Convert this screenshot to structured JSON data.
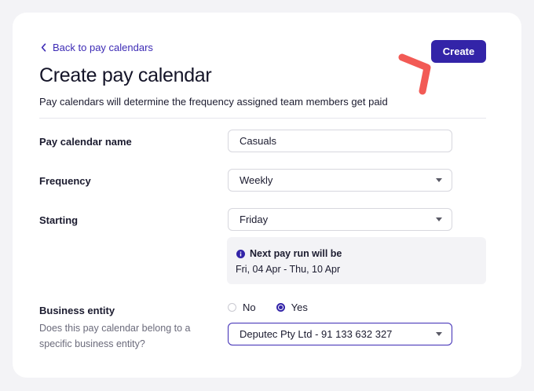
{
  "header": {
    "back_label": "Back to pay calendars",
    "create_label": "Create",
    "title": "Create pay calendar",
    "subtitle": "Pay calendars will determine the frequency assigned team members get paid"
  },
  "form": {
    "name": {
      "label": "Pay calendar name",
      "value": "Casuals"
    },
    "frequency": {
      "label": "Frequency",
      "value": "Weekly"
    },
    "starting": {
      "label": "Starting",
      "value": "Friday"
    },
    "next_pay_run": {
      "title": "Next pay run will be",
      "dates": "Fri, 04 Apr - Thu, 10 Apr"
    },
    "business_entity": {
      "label": "Business entity",
      "help": "Does this pay calendar belong to a specific business entity?",
      "options": {
        "no": "No",
        "yes": "Yes"
      },
      "selected_option": "Yes",
      "entity_value": "Deputec Pty Ltd - 91 133 632 327"
    }
  },
  "colors": {
    "accent": "#3324a8",
    "annotation": "#f25a55",
    "panel_bg": "#f3f3f6"
  },
  "icons": [
    "chevron-left-icon",
    "info-icon",
    "caret-down-icon",
    "annotation-arrow-icon"
  ]
}
